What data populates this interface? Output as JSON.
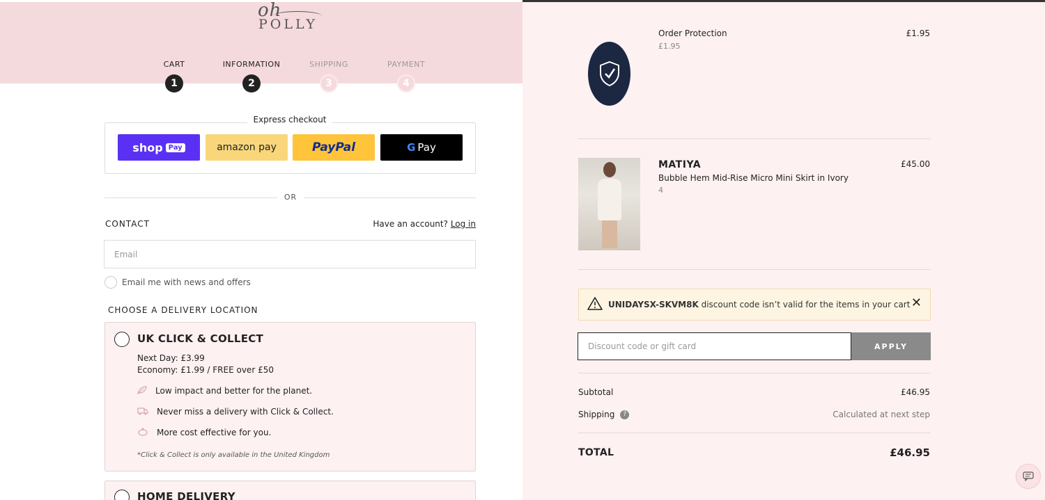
{
  "brand": {
    "logo_top": "oh",
    "logo_bottom": "POLLY"
  },
  "steps": [
    {
      "label": "CART",
      "number": "1",
      "active": true
    },
    {
      "label": "INFORMATION",
      "number": "2",
      "active": true
    },
    {
      "label": "SHIPPING",
      "number": "3",
      "active": false
    },
    {
      "label": "PAYMENT",
      "number": "4",
      "active": false
    }
  ],
  "express": {
    "label": "Express checkout",
    "shop_pay": "shop",
    "shop_pay_tag": "Pay",
    "amazon_pay": "amazon pay",
    "paypal": "PayPal",
    "google_pay_g": "G",
    "google_pay": "Pay"
  },
  "or_text": "OR",
  "contact": {
    "title": "CONTACT",
    "have_account": "Have an account?",
    "login": "Log in",
    "email_placeholder": "Email",
    "newsletter_label": "Email me with news and offers"
  },
  "delivery": {
    "title": "CHOOSE A DELIVERY LOCATION",
    "options": [
      {
        "title": "UK CLICK & COLLECT",
        "next_day": "Next Day: £3.99",
        "economy": "Economy: £1.99 / FREE over £50",
        "features": [
          {
            "icon": "leaf-icon",
            "text": "Low impact and better for the planet."
          },
          {
            "icon": "truck-icon",
            "text": "Never miss a delivery with Click & Collect."
          },
          {
            "icon": "piggy-bank-icon",
            "text": "More cost effective for you."
          }
        ],
        "note": "*Click & Collect is only available in the United Kingdom"
      },
      {
        "title": "HOME DELIVERY"
      }
    ]
  },
  "cart": {
    "items": [
      {
        "name": "Order Protection",
        "sub": "£1.95",
        "price": "£1.95",
        "image": "shield-icon"
      },
      {
        "brand": "MATIYA",
        "name": "Bubble Hem Mid-Rise Micro Mini Skirt in Ivory",
        "sub": "4",
        "price": "£45.00",
        "image": "product-photo"
      }
    ],
    "alert": {
      "code": "UNIDAYSX-SKVM8K",
      "message": "discount code isn’t valid for the items in your cart"
    },
    "discount_placeholder": "Discount code or gift card",
    "apply_label": "APPLY",
    "subtotal_label": "Subtotal",
    "subtotal_value": "£46.95",
    "shipping_label": "Shipping",
    "shipping_value": "Calculated at next step",
    "total_label": "TOTAL",
    "total_value": "£46.95"
  },
  "colors": {
    "header_pink": "#f5dadd",
    "summary_bg": "#fdf1f2",
    "shop_pay": "#5a31f4",
    "amazon_pay": "#f9d67a",
    "paypal": "#ffc439",
    "alert_bg": "#fdf5e2"
  }
}
